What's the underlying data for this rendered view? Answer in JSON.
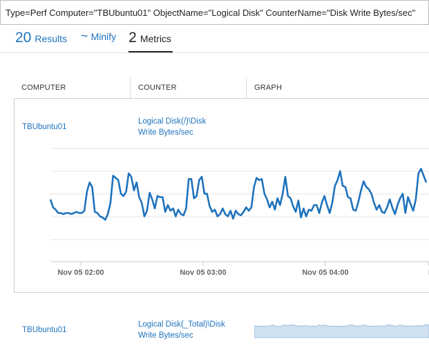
{
  "query": "Type=Perf Computer=\"TBUbuntu01\" ObjectName=\"Logical Disk\" CounterName=\"Disk Write Bytes/sec\"",
  "tabs": {
    "results": {
      "count": "20",
      "label": "Results"
    },
    "minify": {
      "glyph": "~",
      "label": "Minify"
    },
    "metrics": {
      "count": "2",
      "label": "Metrics"
    }
  },
  "columns": {
    "computer": "COMPUTER",
    "counter": "COUNTER",
    "graph": "GRAPH"
  },
  "rows": [
    {
      "computer": "TBUbuntu01",
      "counter_line1": "Logical Disk(/)\\Disk",
      "counter_line2": "Write Bytes/sec"
    },
    {
      "computer": "TBUbuntu01",
      "counter_line1": "Logical Disk(_Total)\\Disk",
      "counter_line2": "Write Bytes/sec"
    }
  ],
  "chart_data": {
    "type": "line",
    "x_ticks": [
      "Nov 05 02:00",
      "Nov 05 03:00",
      "Nov 05 04:00",
      "N"
    ],
    "grid": true,
    "color": "#1e72bd",
    "series_level": [
      0.55,
      0.48,
      0.46,
      0.43,
      0.43,
      0.42,
      0.43,
      0.43,
      0.42,
      0.43,
      0.44,
      0.43,
      0.43,
      0.45,
      0.62,
      0.7,
      0.66,
      0.44,
      0.43,
      0.4,
      0.39,
      0.37,
      0.42,
      0.52,
      0.76,
      0.74,
      0.72,
      0.6,
      0.58,
      0.62,
      0.78,
      0.75,
      0.63,
      0.7,
      0.57,
      0.52,
      0.4,
      0.45,
      0.61,
      0.55,
      0.47,
      0.58,
      0.57,
      0.57,
      0.44,
      0.5,
      0.45,
      0.47,
      0.4,
      0.46,
      0.42,
      0.41,
      0.47,
      0.73,
      0.73,
      0.56,
      0.58,
      0.72,
      0.75,
      0.6,
      0.6,
      0.49,
      0.44,
      0.46,
      0.4,
      0.42,
      0.47,
      0.42,
      0.4,
      0.45,
      0.38,
      0.45,
      0.42,
      0.41,
      0.44,
      0.48,
      0.45,
      0.48,
      0.66,
      0.74,
      0.72,
      0.73,
      0.6,
      0.55,
      0.48,
      0.53,
      0.46,
      0.56,
      0.5,
      0.6,
      0.75,
      0.58,
      0.56,
      0.49,
      0.44,
      0.54,
      0.39,
      0.47,
      0.4,
      0.46,
      0.45,
      0.5,
      0.5,
      0.43,
      0.52,
      0.58,
      0.5,
      0.43,
      0.52,
      0.67,
      0.72,
      0.8,
      0.67,
      0.66,
      0.57,
      0.56,
      0.46,
      0.45,
      0.53,
      0.63,
      0.71,
      0.66,
      0.64,
      0.6,
      0.52,
      0.46,
      0.5,
      0.44,
      0.43,
      0.48,
      0.55,
      0.48,
      0.42,
      0.5,
      0.56,
      0.6,
      0.43,
      0.57,
      0.51,
      0.45,
      0.55,
      0.78,
      0.82,
      0.76,
      0.7
    ]
  }
}
